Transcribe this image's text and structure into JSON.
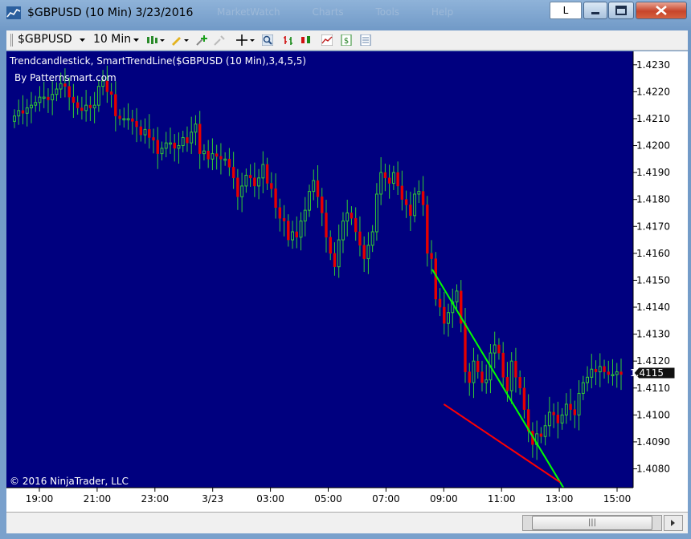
{
  "window": {
    "title": "$GBPUSD (10 Min)  3/23/2016",
    "ghost_menu": [
      "MarketWatch",
      "Charts",
      "Tools",
      "Help"
    ],
    "link_button_label": "L"
  },
  "toolbar": {
    "instrument": "$GBPUSD",
    "interval": "10 Min",
    "icons": [
      "candlestick-style-icon",
      "pencil-draw-icon",
      "add-indicator-icon",
      "remove-indicator-icon",
      "crosshair-icon",
      "zoom-icon",
      "bar-chart-icon",
      "candlestick-chart-icon",
      "line-chart-icon",
      "dollar-data-icon",
      "properties-icon"
    ]
  },
  "chart": {
    "indicator_label": "Trendcandlestick,  SmartTrendLine($GBPUSD  (10  Min),3,4,5,5)",
    "sub_label": "By Patternsmart.com",
    "copyright": "© 2016 NinjaTrader, LLC",
    "last_price": "1.4115",
    "colors": {
      "background": "#00007f",
      "bull": "#33cc33",
      "bear": "#e60000",
      "wick": "#33cc33",
      "upper_trend": "#00ff00",
      "lower_trend": "#ff0000",
      "axis_bg": "#ffffff"
    }
  },
  "chart_data": {
    "type": "candlestick",
    "ylim": [
      1.4073,
      1.4235
    ],
    "y_ticks": [
      "1.4230",
      "1.4220",
      "1.4210",
      "1.4200",
      "1.4190",
      "1.4180",
      "1.4170",
      "1.4160",
      "1.4150",
      "1.4140",
      "1.4130",
      "1.4120",
      "1.4110",
      "1.4100",
      "1.4090",
      "1.4080"
    ],
    "x_ticks": [
      "19:00",
      "21:00",
      "23:00",
      "3/23",
      "03:00",
      "05:00",
      "07:00",
      "09:00",
      "11:00",
      "13:00",
      "15:00"
    ],
    "closes": [
      1.4211,
      1.4213,
      1.4212,
      1.4214,
      1.4215,
      1.4216,
      1.4218,
      1.4218,
      1.4217,
      1.4219,
      1.4221,
      1.4223,
      1.4222,
      1.4218,
      1.4216,
      1.4214,
      1.4213,
      1.4215,
      1.4214,
      1.4215,
      1.4222,
      1.4224,
      1.422,
      1.4219,
      1.4211,
      1.421,
      1.421,
      1.421,
      1.4209,
      1.4207,
      1.4204,
      1.4206,
      1.4203,
      1.4202,
      1.4197,
      1.4199,
      1.4201,
      1.4201,
      1.4199,
      1.42,
      1.4203,
      1.4201,
      1.4205,
      1.4208,
      1.4197,
      1.4198,
      1.4195,
      1.4197,
      1.4196,
      1.4195,
      1.4195,
      1.4192,
      1.4188,
      1.4181,
      1.4185,
      1.4189,
      1.4188,
      1.4185,
      1.4188,
      1.4193,
      1.4186,
      1.4184,
      1.4177,
      1.4173,
      1.4172,
      1.4165,
      1.4168,
      1.4166,
      1.4172,
      1.4176,
      1.4183,
      1.4187,
      1.4181,
      1.4175,
      1.4166,
      1.416,
      1.4155,
      1.4165,
      1.4172,
      1.4175,
      1.4173,
      1.4168,
      1.4163,
      1.4158,
      1.4163,
      1.4168,
      1.4182,
      1.419,
      1.4188,
      1.4186,
      1.419,
      1.4185,
      1.418,
      1.4178,
      1.4174,
      1.4182,
      1.4183,
      1.4178,
      1.416,
      1.4158,
      1.4143,
      1.414,
      1.4134,
      1.4138,
      1.4142,
      1.4146,
      1.4134,
      1.4116,
      1.4112,
      1.412,
      1.4116,
      1.4112,
      1.4113,
      1.4123,
      1.4126,
      1.4123,
      1.4114,
      1.4109,
      1.412,
      1.4114,
      1.411,
      1.4102,
      1.4094,
      1.4089,
      1.4093,
      1.4092,
      1.4096,
      1.4101,
      1.41,
      1.4097,
      1.41,
      1.4104,
      1.4102,
      1.41,
      1.4108,
      1.4112,
      1.4114,
      1.4117,
      1.4116,
      1.4118,
      1.4116,
      1.4115,
      1.4115,
      1.4116,
      1.4115
    ],
    "trendlines": [
      {
        "name": "upper",
        "x": [
          0.6795,
          0.8965
        ],
        "y": [
          1.4154,
          1.407
        ]
      },
      {
        "name": "lower",
        "x": [
          0.6979,
          0.8835
        ],
        "y": [
          1.4104,
          1.4075
        ]
      }
    ]
  }
}
